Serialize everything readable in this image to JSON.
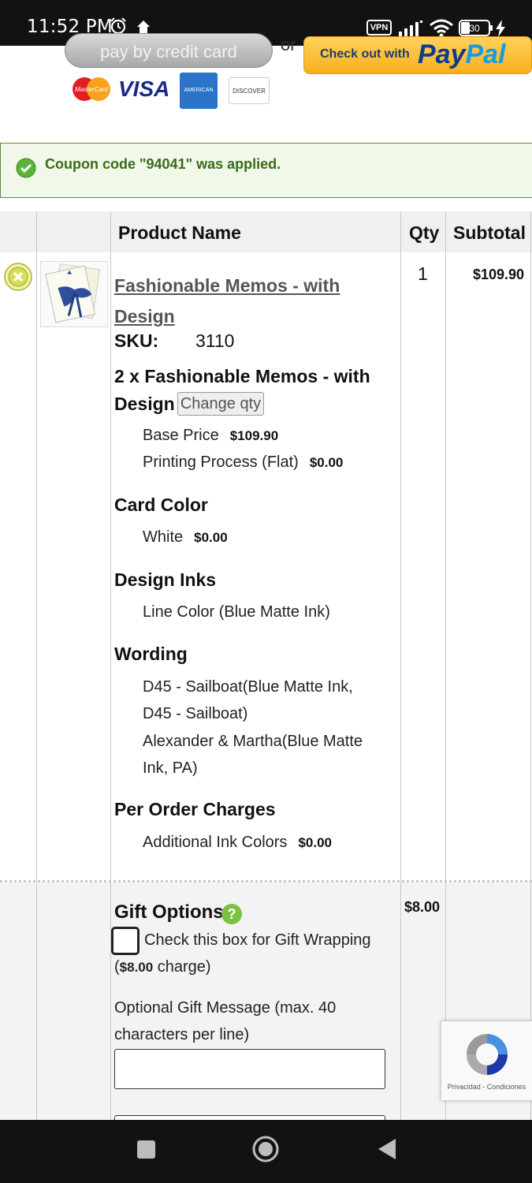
{
  "status_bar": {
    "time": "11:52 PM",
    "vpn": "VPN",
    "battery": "30"
  },
  "payment": {
    "pay_by_card_label": "pay by credit card",
    "or_label": "or",
    "paypal_prefix": "Check out with",
    "paypal_brand_pay": "Pay",
    "paypal_brand_pal": "Pal",
    "cards": {
      "mastercard": "MasterCard",
      "visa": "VISA",
      "amex": "AMERICAN EXPRESS",
      "discover": "DISCOVER"
    }
  },
  "coupon": {
    "message": "Coupon code \"94041\" was applied."
  },
  "table": {
    "headers": {
      "product": "Product Name",
      "qty": "Qty",
      "subtotal": "Subtotal"
    }
  },
  "item": {
    "name": "Fashionable Memos - with Design",
    "sku_label": "SKU:",
    "sku_value": "3110",
    "options_title": "2 x Fashionable Memos - with Design",
    "change_qty_label": "Change qty",
    "base_price_label": "Base Price",
    "base_price_value": "$109.90",
    "printing_label": "Printing Process (Flat)",
    "printing_value": "$0.00",
    "card_color_title": "Card Color",
    "card_color_label": "White",
    "card_color_value": "$0.00",
    "design_inks_title": "Design Inks",
    "design_inks_value": "Line Color (Blue Matte Ink)",
    "wording_title": "Wording",
    "wording_1": "D45 - Sailboat(Blue Matte Ink, D45 - Sailboat)",
    "wording_2": "Alexander & Martha(Blue Matte Ink, PA)",
    "per_order_title": "Per Order Charges",
    "ink_colors_label": "Additional Ink Colors",
    "ink_colors_value": "$0.00",
    "qty": "1",
    "subtotal": "$109.90"
  },
  "gift": {
    "title": "Gift Options",
    "help": "?",
    "price": "$8.00",
    "wrap_label_main": "Check this box for Gift Wrapping (",
    "wrap_label_price": "$8.00",
    "wrap_label_tail": " charge)",
    "message_label": "Optional Gift Message (max. 40 characters per line)",
    "message_value": ""
  },
  "recaptcha": {
    "terms": "Privacidad - Condiciones"
  },
  "colors": {
    "coupon_text": "#3a6b16",
    "coupon_bg": "#f1f8ea",
    "help_green": "#7cc242",
    "link_gray": "#555555"
  }
}
